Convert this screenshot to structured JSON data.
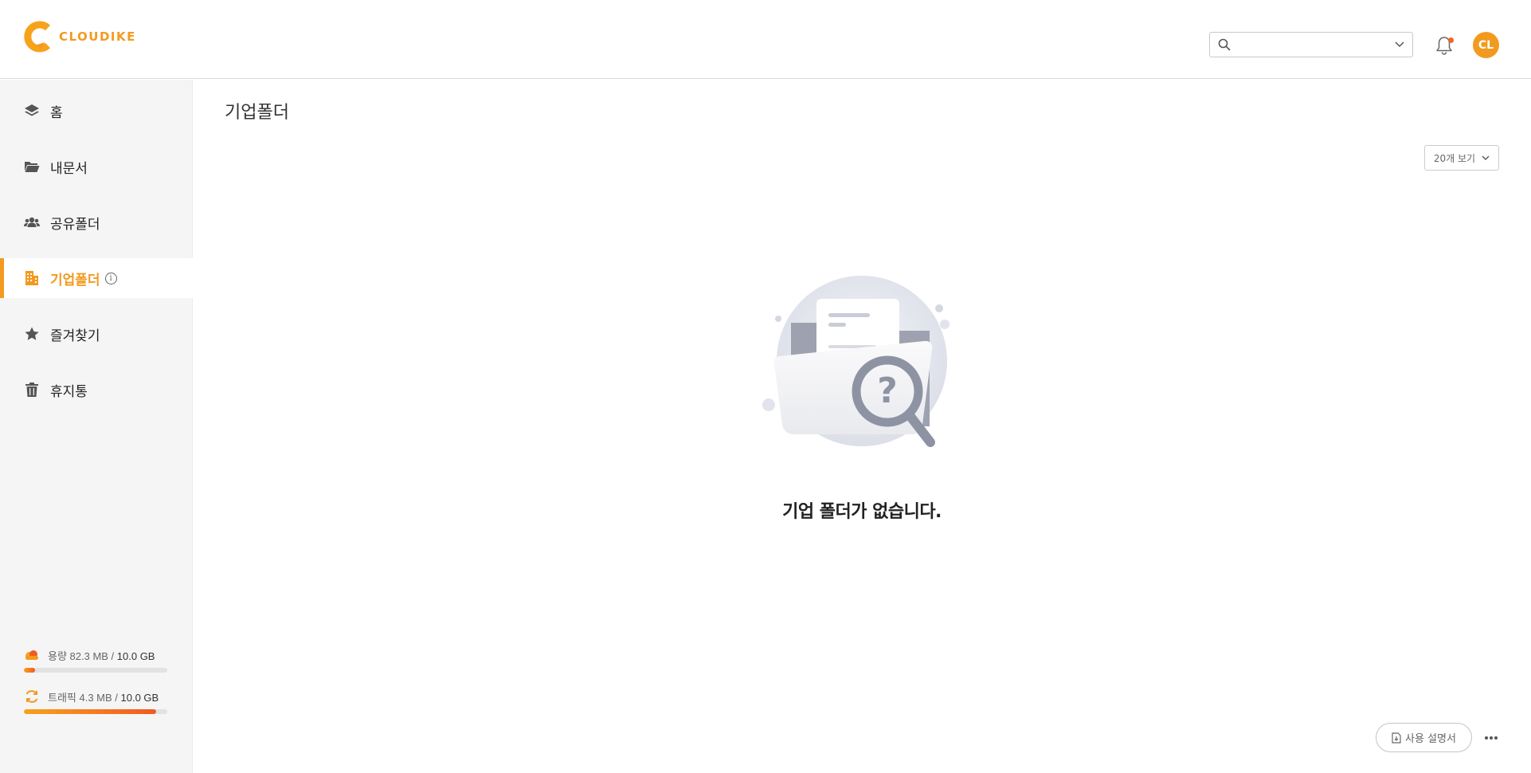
{
  "header": {
    "logo_text": "CLOUDIKE",
    "search": {
      "value": "",
      "placeholder": ""
    },
    "avatar_initials": "CL",
    "brand_color": "#f29a1f",
    "notification_dot_color": "#f26522"
  },
  "sidebar": {
    "items": [
      {
        "label": "홈",
        "icon": "layers-icon",
        "active": false
      },
      {
        "label": "내문서",
        "icon": "folder-open-icon",
        "active": false
      },
      {
        "label": "공유폴더",
        "icon": "users-icon",
        "active": false
      },
      {
        "label": "기업폴더",
        "icon": "building-icon",
        "active": true,
        "info_glyph": "i"
      },
      {
        "label": "즐겨찾기",
        "icon": "star-icon",
        "active": false
      },
      {
        "label": "휴지통",
        "icon": "trash-icon",
        "active": false
      }
    ],
    "usage": {
      "storage": {
        "label": "용량 82.3 MB / ",
        "total": "10.0 GB",
        "fill_fraction": 0.08,
        "icon": "cloud-icon"
      },
      "traffic": {
        "label": "트래픽 4.3 MB / ",
        "total": "10.0 GB",
        "fill_fraction": 0.92,
        "icon": "sync-icon"
      }
    }
  },
  "main": {
    "title": "기업폴더",
    "per_page_label": "20개 보기",
    "empty_message": "기업 폴더가 없습니다.",
    "empty_illustration_icon": "empty-folder-search-icon",
    "manual_button_label": "사용 설명서",
    "more_icon": "more-horizontal-icon"
  }
}
